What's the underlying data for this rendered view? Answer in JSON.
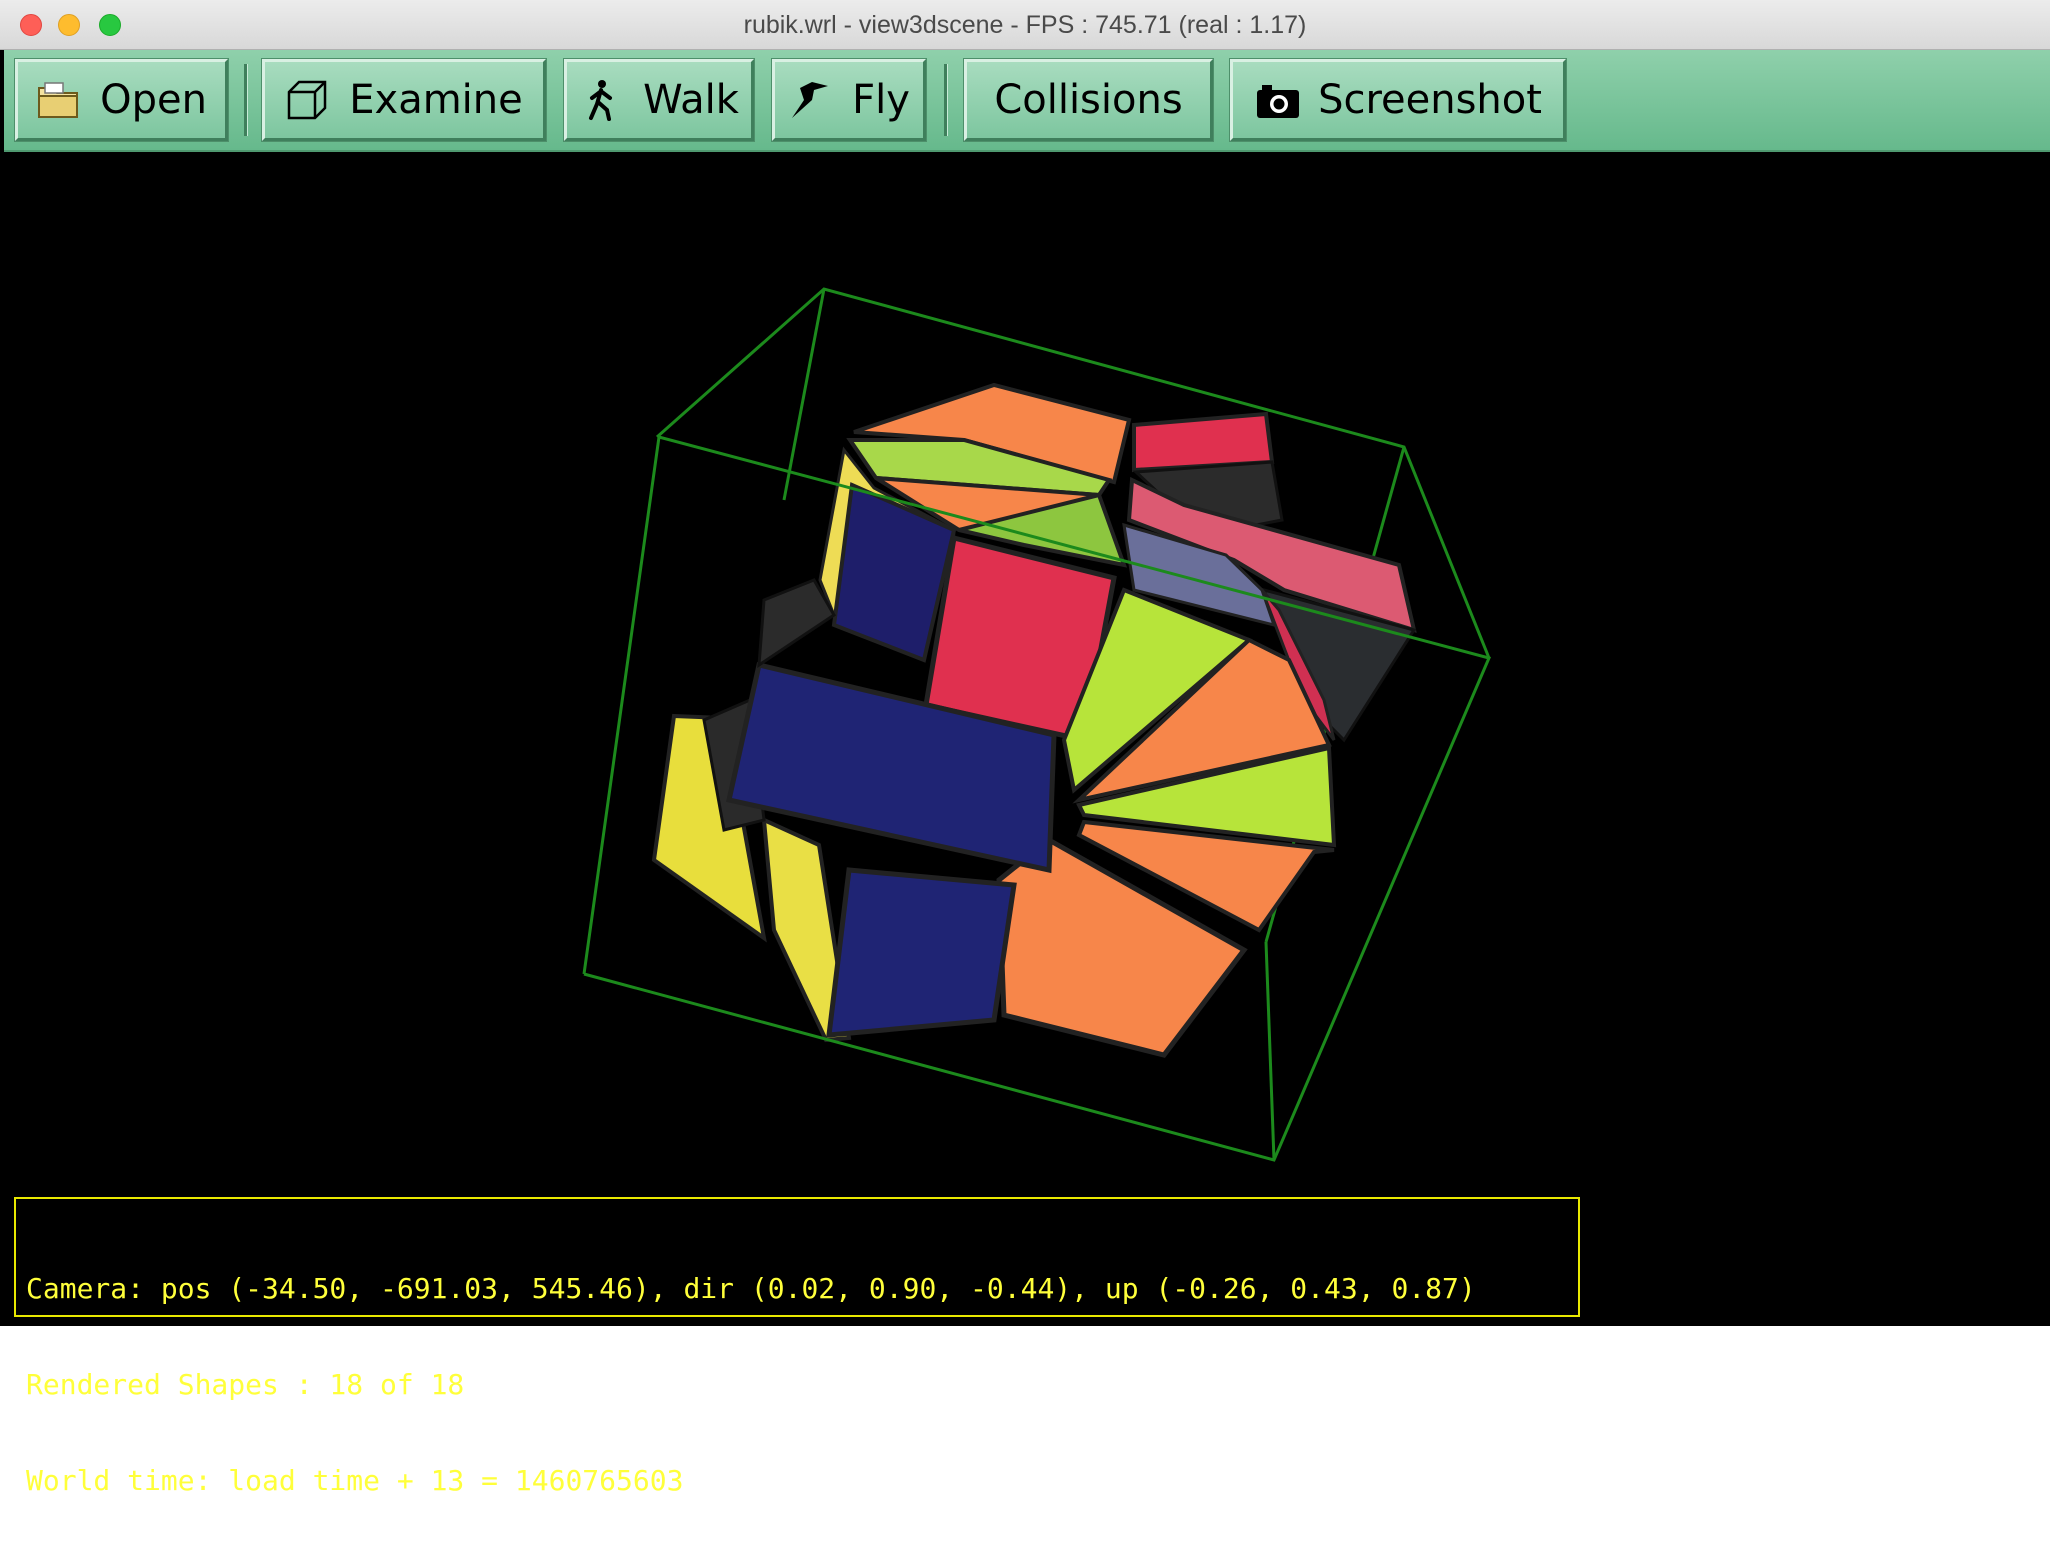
{
  "window": {
    "title": "rubik.wrl - view3dscene - FPS : 745.71 (real : 1.17)"
  },
  "toolbar": {
    "buttons": [
      {
        "label": "Open",
        "icon": "folder-icon"
      },
      {
        "label": "Examine",
        "icon": "cube-icon"
      },
      {
        "label": "Walk",
        "icon": "walking-person-icon"
      },
      {
        "label": "Fly",
        "icon": "bird-icon"
      },
      {
        "label": "Collisions",
        "icon": ""
      },
      {
        "label": "Screenshot",
        "icon": "camera-icon"
      }
    ]
  },
  "status": {
    "line1": "Camera: pos (-34.50, -691.03, 545.46), dir (0.02, 0.90, -0.44), up (-0.26, 0.43, 0.87)",
    "line2": "Rendered Shapes : 18 of 18",
    "line3": "World time: load time + 13 = 1460765603"
  },
  "colors": {
    "toolbar": "#7cc49d",
    "bounding_box": "#1c8a1c",
    "status_text": "#ffff3a",
    "cube_orange": "#f7864a",
    "cube_green": "#b7e43a",
    "cube_red": "#e0304f",
    "cube_blue": "#1c1c6e",
    "cube_yellow": "#e8de3c"
  }
}
